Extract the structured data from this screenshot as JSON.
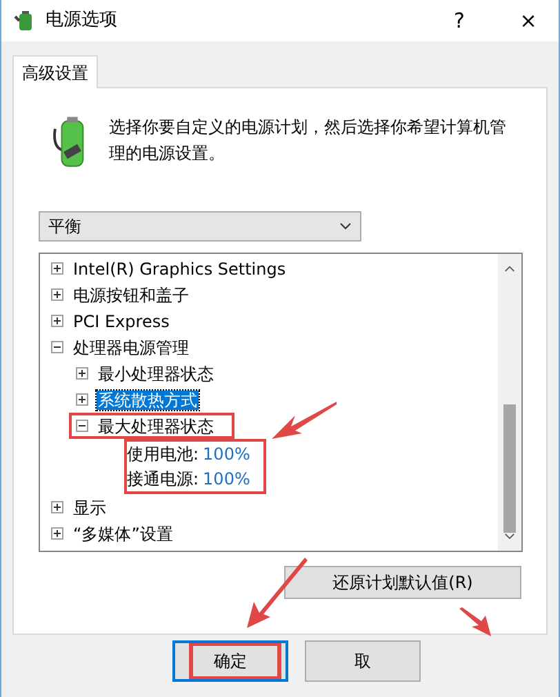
{
  "window": {
    "title": "电源选项",
    "help": "?",
    "close": "×"
  },
  "tabs": [
    {
      "label": "高级设置",
      "selected": true
    }
  ],
  "description": "选择你要自定义的电源计划，然后选择你希望计算机管理的电源设置。",
  "plan_dropdown": {
    "value": "平衡"
  },
  "tree": [
    {
      "label": "Intel(R) Graphics Settings",
      "expanded": false,
      "selected": false,
      "highlighted": false
    },
    {
      "label": "电源按钮和盖子",
      "expanded": false,
      "selected": false,
      "highlighted": false
    },
    {
      "label": "PCI Express",
      "expanded": false,
      "selected": false,
      "highlighted": false
    },
    {
      "label": "处理器电源管理",
      "expanded": true,
      "selected": false,
      "highlighted": false,
      "children": [
        {
          "label": "最小处理器状态",
          "expanded": false,
          "selected": false,
          "highlighted": false
        },
        {
          "label": "系统散热方式",
          "expanded": false,
          "selected": true,
          "highlighted": false
        },
        {
          "label": "最大处理器状态",
          "expanded": true,
          "selected": false,
          "highlighted": true,
          "settings_highlighted": true,
          "settings": [
            {
              "label": "使用电池:",
              "value": "100%"
            },
            {
              "label": "接通电源:",
              "value": "100%"
            }
          ]
        }
      ]
    },
    {
      "label": "显示",
      "expanded": false,
      "selected": false,
      "highlighted": false
    },
    {
      "label": "“多媒体”设置",
      "expanded": false,
      "selected": false,
      "highlighted": false
    }
  ],
  "restore_button": "还原计划默认值(R)",
  "buttons": [
    {
      "label": "确定",
      "default": true,
      "highlighted": true
    },
    {
      "label": "取",
      "default": false,
      "highlighted": false
    }
  ]
}
